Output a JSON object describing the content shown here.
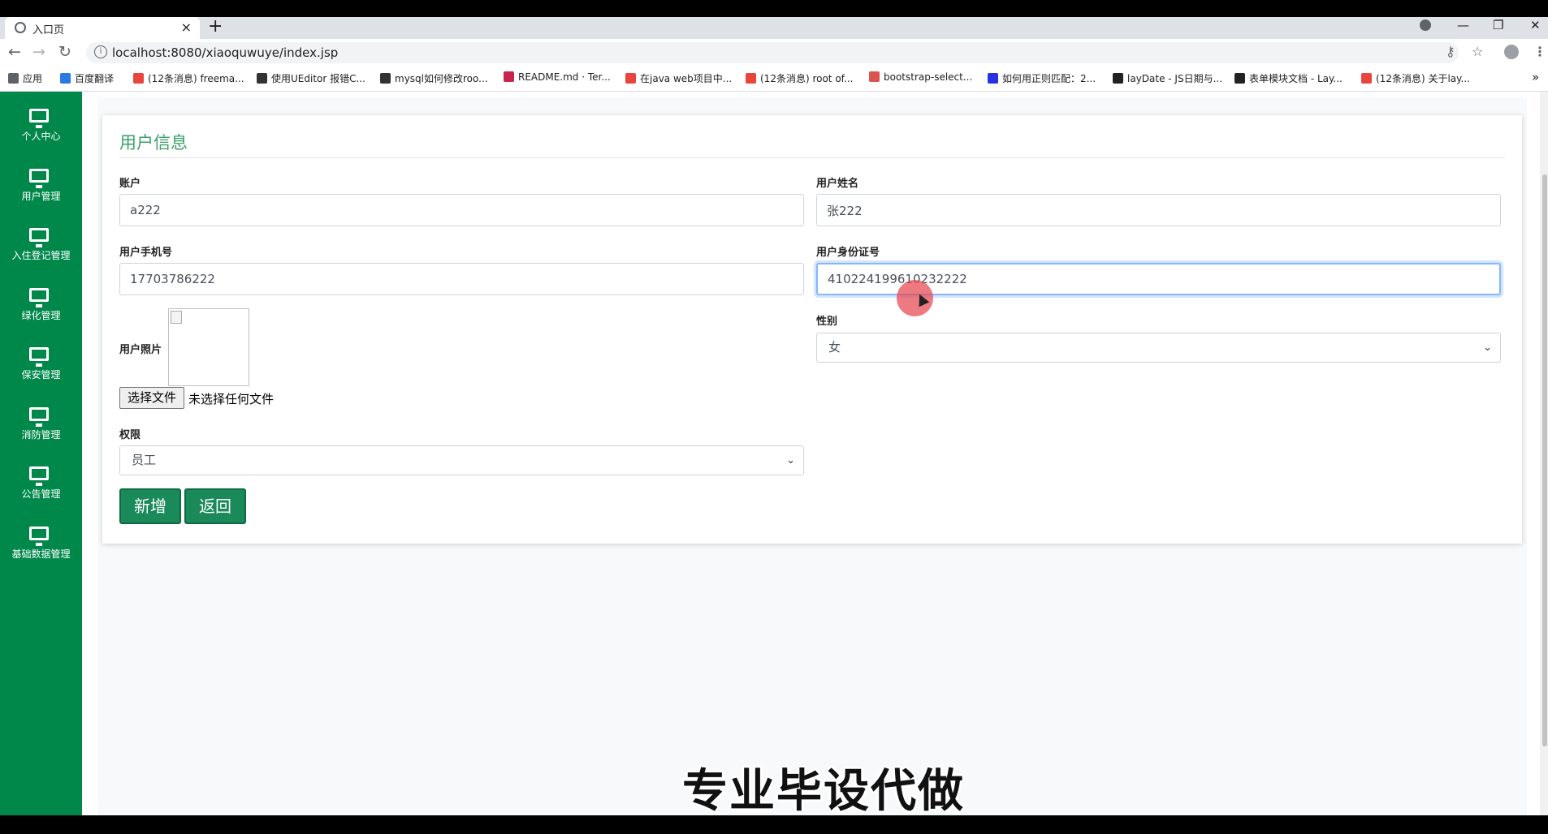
{
  "browser": {
    "tab_title": "入口页",
    "tab_close": "×",
    "new_tab": "+",
    "url": "localhost:8080/xiaoquwuye/index.jsp",
    "window_controls": [
      "—",
      "❐",
      "✕"
    ],
    "bookmarks": [
      {
        "label": "应用",
        "color": "#5f6368"
      },
      {
        "label": "百度翻译",
        "color": "#2a7ae2"
      },
      {
        "label": "(12条消息) freema...",
        "color": "#e8453c"
      },
      {
        "label": "使用UEditor 报错C...",
        "color": "#333333"
      },
      {
        "label": "mysql如何修改roo...",
        "color": "#333333"
      },
      {
        "label": "README.md · Ter...",
        "color": "#c7254e"
      },
      {
        "label": "在java web项目中...",
        "color": "#e8453c"
      },
      {
        "label": "(12条消息) root of...",
        "color": "#e8453c"
      },
      {
        "label": "bootstrap-select...",
        "color": "#d9534f"
      },
      {
        "label": "如何用正则匹配：2...",
        "color": "#2932e1"
      },
      {
        "label": "layDate - JS日期与...",
        "color": "#222222"
      },
      {
        "label": "表单模块文档 - Lay...",
        "color": "#222222"
      },
      {
        "label": "(12条消息) 关于lay...",
        "color": "#e8453c"
      }
    ],
    "bookmarks_more": "»"
  },
  "sidebar": {
    "items": [
      {
        "label": "个人中心"
      },
      {
        "label": "用户管理"
      },
      {
        "label": "入住登记管理"
      },
      {
        "label": "绿化管理"
      },
      {
        "label": "保安管理"
      },
      {
        "label": "消防管理"
      },
      {
        "label": "公告管理"
      },
      {
        "label": "基础数据管理"
      }
    ]
  },
  "form": {
    "title": "用户信息",
    "account_label": "账户",
    "account_value": "a222",
    "name_label": "用户姓名",
    "name_value": "张222",
    "phone_label": "用户手机号",
    "phone_value": "17703786222",
    "idcard_label": "用户身份证号",
    "idcard_value": "410224199610232222",
    "photo_label": "用户照片",
    "file_button": "选择文件",
    "file_status": "未选择任何文件",
    "gender_label": "性别",
    "gender_value": "女",
    "role_label": "权限",
    "role_value": "员工",
    "add_button": "新增",
    "back_button": "返回"
  },
  "overlay": {
    "watermark": "专业毕设代做"
  }
}
